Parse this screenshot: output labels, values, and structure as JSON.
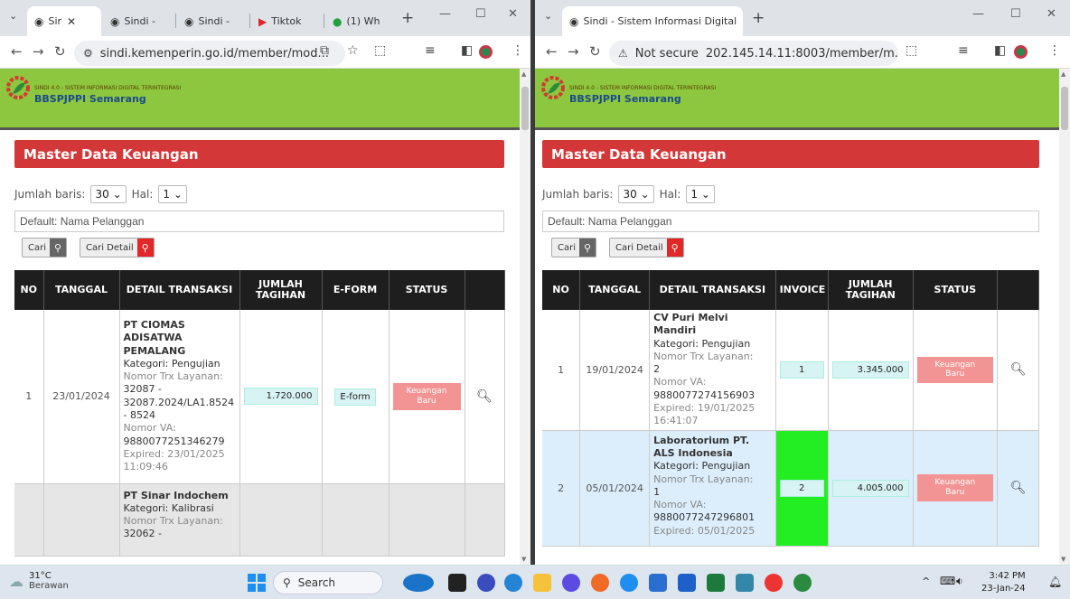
{
  "browser1": {
    "tabs": [
      {
        "label": "Sir",
        "favicon": "globe-icon"
      },
      {
        "label": "Sindi -",
        "favicon": "globe-icon"
      },
      {
        "label": "Sindi -",
        "favicon": "globe-icon"
      },
      {
        "label": "Tiktok",
        "favicon": "tiktok-icon"
      },
      {
        "label": "(1) Wh",
        "favicon": "whatsapp-icon"
      }
    ],
    "url": "sindi.kemenperin.go.id/member/mod..."
  },
  "browser2": {
    "tabs": [
      {
        "label": "Sindi - Sistem Informasi Digital",
        "favicon": "globe-icon"
      }
    ],
    "url_warning": "Not secure",
    "url": "202.145.14.11:8003/member/m..."
  },
  "site": {
    "tagline": "SINDI 4.0 - SISTEM INFORMASI DIGITAL TERINTEGRASI",
    "brand": "BBSPJPPI Semarang",
    "page_title": "Master Data Keuangan",
    "rows_label": "Jumlah baris:",
    "rows_value": "30",
    "page_label": "Hal:",
    "page_value": "1",
    "search_placeholder": "Default: Nama Pelanggan",
    "cari": "Cari",
    "cari_detail": "Cari Detail"
  },
  "table1": {
    "headers": [
      "NO",
      "TANGGAL",
      "DETAIL TRANSAKSI",
      "JUMLAH TAGIHAN",
      "E-FORM",
      "STATUS",
      ""
    ],
    "rows": [
      {
        "no": "1",
        "tanggal": "23/01/2024",
        "nama": "PT CIOMAS ADISATWA PEMALANG",
        "kategori": "Kategori: Pengujian",
        "trx_label": "Nomor Trx Layanan:",
        "trx": "32087 - 32087.2024/LA1.8524 - 8524",
        "va_label": "Nomor VA:",
        "va": "9880077251346279",
        "expired": "Expired: 23/01/2025 11:09:46",
        "jumlah": "1.720.000",
        "eform": "E-form",
        "status": "Keuangan Baru"
      },
      {
        "no": "",
        "tanggal": "",
        "nama": "PT Sinar Indochem",
        "kategori": "Kategori: Kalibrasi",
        "trx_label": "Nomor Trx Layanan:",
        "trx": "32062 -",
        "va_label": "",
        "va": "",
        "expired": "",
        "jumlah": "",
        "eform": "",
        "status": ""
      }
    ]
  },
  "table2": {
    "headers": [
      "NO",
      "TANGGAL",
      "DETAIL TRANSAKSI",
      "INVOICE",
      "JUMLAH TAGIHAN",
      "STATUS",
      ""
    ],
    "rows": [
      {
        "no": "1",
        "tanggal": "19/01/2024",
        "nama": "CV Puri Melvi Mandiri",
        "kategori": "Kategori: Pengujian",
        "trx_label": "Nomor Trx Layanan:",
        "trx": "2",
        "va_label": "Nomor VA:",
        "va": "9880077274156903",
        "expired": "Expired: 19/01/2025 16:41:07",
        "invoice": "1",
        "jumlah": "3.345.000",
        "status": "Keuangan Baru"
      },
      {
        "no": "2",
        "tanggal": "05/01/2024",
        "nama": "Laboratorium PT. ALS Indonesia",
        "kategori": "Kategori: Pengujian",
        "trx_label": "Nomor Trx Layanan:",
        "trx": "1",
        "va_label": "Nomor VA:",
        "va": "9880077247296801",
        "expired": "Expired: 05/01/2025",
        "invoice": "2",
        "jumlah": "4.005.000",
        "status": "Keuangan Baru"
      }
    ]
  },
  "taskbar": {
    "weather_temp": "31°C",
    "weather_desc": "Berawan",
    "search": "Search",
    "time": "3:42 PM",
    "date": "23-Jan-24"
  },
  "colors": {
    "header_green": "#8dc63f",
    "title_red": "#d43737",
    "status_pink": "#f29494",
    "invoice_green": "#22ee22",
    "row_highlight": "#dceefc"
  }
}
